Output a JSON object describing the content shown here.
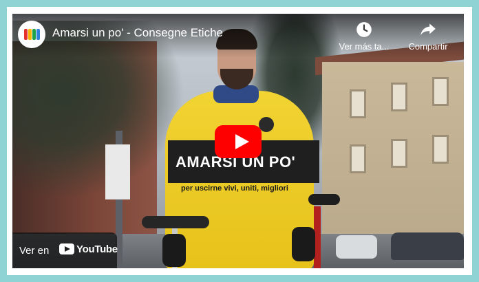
{
  "colors": {
    "frame_border": "#8fd3d4",
    "play_button": "#ff0000",
    "title_card_bg": "#1f1f1f"
  },
  "header": {
    "channel_avatar_icon": "channel-avatar-icon",
    "video_title": "Amarsi un po' - Consegne Etiche",
    "watch_later_label": "Ver más ta...",
    "watch_later_icon": "clock-icon",
    "share_label": "Compartir",
    "share_icon": "share-arrow-icon"
  },
  "video": {
    "overlay_title": "AMARSI UN PO'",
    "overlay_subtitle": "per uscirne vivi, uniti, migliori",
    "play_icon": "play-icon"
  },
  "footer": {
    "watch_on_label": "Ver en",
    "youtube_wordmark": "YouTube",
    "youtube_icon": "youtube-logo-icon"
  }
}
